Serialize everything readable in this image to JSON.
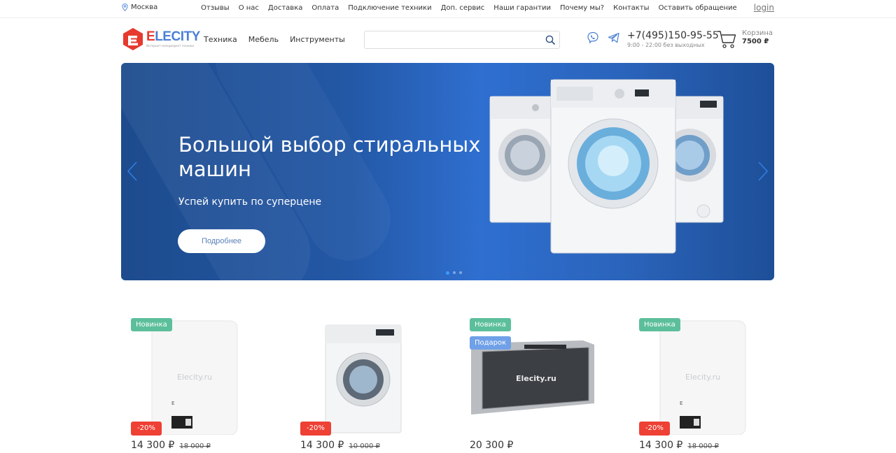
{
  "topbar": {
    "city": "Москва",
    "links": [
      "Отзывы",
      "О нас",
      "Доставка",
      "Оплата",
      "Подключение техники",
      "Доп. сервис",
      "Наши гарантии",
      "Почему мы?",
      "Контакты",
      "Оставить обращение"
    ],
    "login": "login"
  },
  "header": {
    "logo_name_e": "E",
    "logo_name_rest": "LECITY",
    "logo_tagline": "Интернет-гипермаркет техники",
    "nav": [
      "Техника",
      "Мебель",
      "Инструменты"
    ],
    "search_placeholder": "",
    "phone": "+7(495)150-95-55",
    "hours": "9:00 - 22:00 без выходных",
    "cart_label": "Корзина",
    "cart_sum": "7500 ₽"
  },
  "hero": {
    "title": "Большой выбор стиральных машин",
    "subtitle": "Успей купить по суперцене",
    "button": "Подробнее",
    "slides_count": 3,
    "active_slide": 1
  },
  "products": [
    {
      "badges": [
        "Новинка"
      ],
      "discount": "-20%",
      "price": "14 300 ₽",
      "old_price": "18 000 ₽",
      "image": "water-heater",
      "watermark": "Elecity.ru"
    },
    {
      "badges": [],
      "discount": "-20%",
      "price": "14 300 ₽",
      "old_price": "10 000 ₽",
      "image": "washing-machine",
      "watermark": ""
    },
    {
      "badges": [
        "Новинка",
        "Подарок"
      ],
      "discount": "",
      "price": "20 300 ₽",
      "old_price": "",
      "image": "built-in-oven",
      "watermark": "Elecity.ru"
    },
    {
      "badges": [
        "Новинка"
      ],
      "discount": "-20%",
      "price": "14 300 ₽",
      "old_price": "18 000 ₽",
      "image": "water-heater",
      "watermark": "Elecity.ru"
    }
  ],
  "colors": {
    "accent": "#4a7fd6",
    "brand_red": "#e63a2f",
    "badge_new": "#5cbf9b",
    "badge_gift": "#6fa0e8",
    "badge_discount": "#ee4034"
  }
}
